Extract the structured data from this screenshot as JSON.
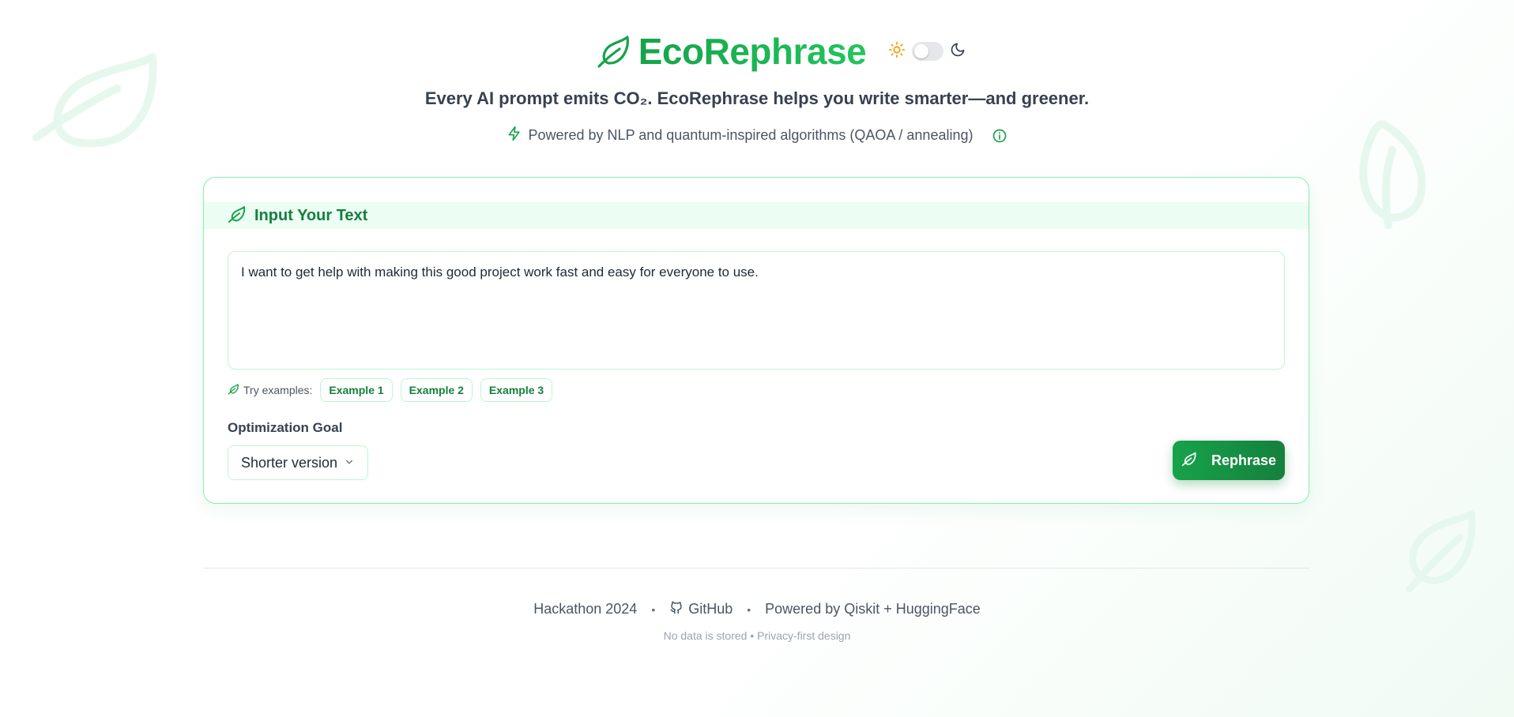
{
  "brand": {
    "title": "EcoRephrase",
    "logo_icon": "leaf-icon",
    "accent": "#16a34a"
  },
  "theme_toggle": {
    "light_icon": "sun-icon",
    "dark_icon": "moon-icon",
    "state": "light"
  },
  "tagline": "Every AI prompt emits CO₂. EcoRephrase helps you write smarter—and greener.",
  "powered_by": {
    "icon": "lightning-icon",
    "text": "Powered by NLP and quantum-inspired algorithms (QAOA / annealing)",
    "info_icon": "info-icon"
  },
  "input_card": {
    "title": "Input Your Text",
    "text": "I want to get help with making this good project work fast and easy for everyone to use.",
    "examples_label": "Try examples:",
    "examples": [
      "Example 1",
      "Example 2",
      "Example 3"
    ],
    "goal_label": "Optimization Goal",
    "goal_selected": "Shorter version",
    "submit_label": "Rephrase"
  },
  "footer": {
    "hackathon": "Hackathon 2024",
    "github": "GitHub",
    "powered": "Powered by Qiskit + HuggingFace",
    "separator": "•",
    "privacy": "No data is stored • Privacy-first design"
  }
}
